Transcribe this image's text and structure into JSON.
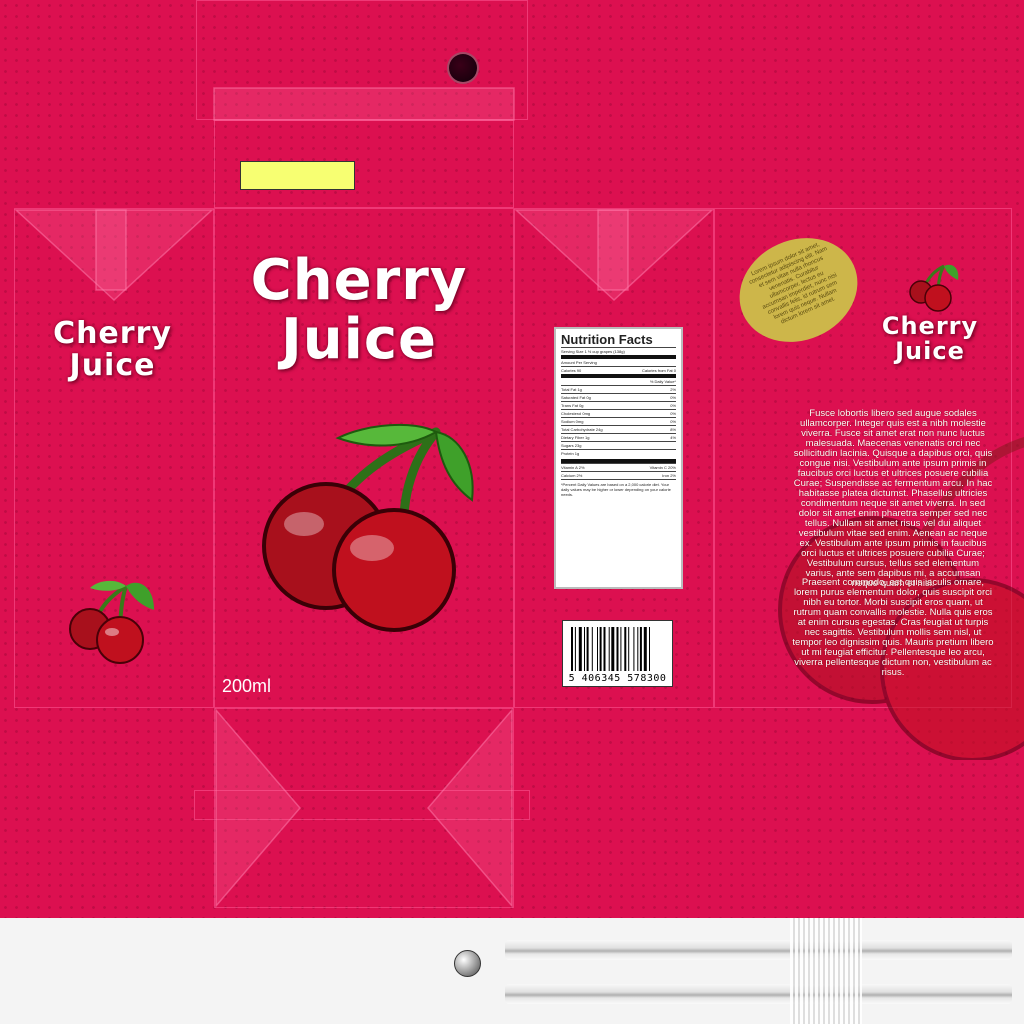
{
  "colors": {
    "background": "#dc1050",
    "cherry": "#c0101e",
    "leaf": "#3fa02a",
    "label_yellow": "#f7ff72",
    "oval": "#cdb64a"
  },
  "front": {
    "title_line1": "Cherry",
    "title_line2": "Juice",
    "volume": "200ml"
  },
  "left_side": {
    "title_line1": "Cherry",
    "title_line2": "Juice"
  },
  "right_side": {
    "title_line1": "Cherry",
    "title_line2": "Juice",
    "oval_text": "Lorem ipsum dolor sit amet, consectetur adipiscing elit. Nam et sem vitae nulla rhoncus venenatis. Curabitur ullamcorper, lectus eu accumsan imperdiet, nunc nisi convallis felis, id rutrum sem lorem quis neque. Nullam dictum lorem sit amet.",
    "paragraph1": "Fusce lobortis libero sed augue sodales ullamcorper. Integer quis est a nibh molestie viverra. Fusce sit amet erat non nunc luctus malesuada. Maecenas venenatis orci nec sollicitudin lacinia. Quisque a dapibus orci, quis congue nisi. Vestibulum ante ipsum primis in faucibus orci luctus et ultrices posuere cubilia Curae; Suspendisse ac fermentum arcu. In hac habitasse platea dictumst. Phasellus ultricies condimentum neque sit amet viverra. In sed dolor sit amet enim pharetra semper sed nec tellus. Nullam sit amet risus vel dui aliquet vestibulum vitae sed enim. Aenean ac neque ex. Vestibulum ante ipsum primis in faucibus orci luctus et ultrices posuere cubilia Curae; Vestibulum cursus, tellus sed elementum varius, ante sem dapibus mi, a accumsan neque quam et nisi.",
    "paragraph2": "Praesent commodo, est quis iaculis ornare, lorem purus elementum dolor, quis suscipit orci nibh eu tortor. Morbi suscipit eros quam, ut rutrum quam convallis molestie. Nulla quis eros at enim cursus egestas. Cras feugiat ut turpis nec sagittis. Vestibulum mollis sem nisl, ut tempor leo dignissim quis. Mauris pretium libero ut mi feugiat efficitur. Pellentesque leo arcu, viverra pellentesque dictum non, vestibulum ac risus."
  },
  "nutrition": {
    "title": "Nutrition Facts",
    "serving": "Serving Size 1 ½ cup grapes (138g)",
    "per_container": "Amount Per Serving",
    "calories": "Calories 90",
    "calories_fat": "Calories from Fat 0",
    "daily_value_header": "% Daily Value*",
    "rows": [
      {
        "label": "Total Fat 1g",
        "value": "2%"
      },
      {
        "label": "Saturated Fat 0g",
        "value": "0%"
      },
      {
        "label": "Trans Fat 0g",
        "value": "0%"
      },
      {
        "label": "Cholesterol 0mg",
        "value": "0%"
      },
      {
        "label": "Sodium 0mg",
        "value": "0%"
      },
      {
        "label": "Total Carbohydrate 24g",
        "value": "8%"
      },
      {
        "label": "Dietary Fiber 1g",
        "value": "4%"
      },
      {
        "label": "Sugars 23g",
        "value": ""
      },
      {
        "label": "Protein 1g",
        "value": ""
      }
    ],
    "vitamins": [
      {
        "left": "Vitamin A 2%",
        "right": "Vitamin C 20%"
      },
      {
        "left": "Calcium 2%",
        "right": "Iron 2%"
      }
    ],
    "footnote": "*Percent Daily Values are based on a 2,000 calorie diet. Your daily values may be higher or lower depending on your calorie needs."
  },
  "barcode": {
    "number": "5 406345 578300"
  }
}
